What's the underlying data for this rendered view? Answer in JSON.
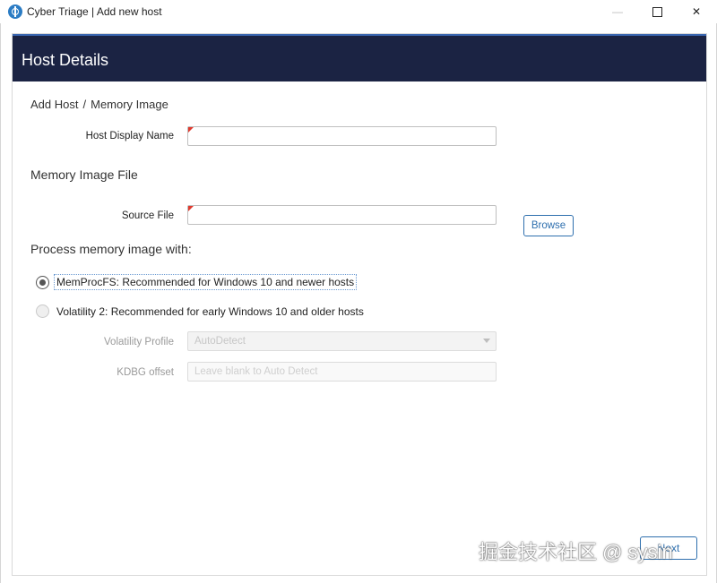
{
  "window": {
    "title": "Cyber Triage | Add new host",
    "minimize_glyph": "—",
    "close_glyph": "✕"
  },
  "header": {
    "title": "Host Details"
  },
  "breadcrumb": {
    "items": [
      "Add Host",
      "Memory Image"
    ],
    "separator": "/"
  },
  "host_name": {
    "label": "Host Display Name",
    "value": "",
    "placeholder": ""
  },
  "memory_section": {
    "title": "Memory Image File"
  },
  "source_file": {
    "label": "Source File",
    "value": "",
    "placeholder": "",
    "browse_label": "Browse"
  },
  "process_section": {
    "title": "Process memory image with:"
  },
  "options": [
    {
      "label": "MemProcFS: Recommended for Windows 10 and newer hosts",
      "selected": true
    },
    {
      "label": "Volatility 2: Recommended for early Windows 10 and older hosts",
      "selected": false
    }
  ],
  "volatility_profile": {
    "label": "Volatility Profile",
    "value": "AutoDetect",
    "enabled": false
  },
  "kdbg_offset": {
    "label": "KDBG offset",
    "value": "",
    "placeholder": "Leave blank to Auto Detect",
    "enabled": false
  },
  "footer": {
    "next_label": "Next"
  },
  "watermark": "掘金技术社区 @ sysin",
  "colors": {
    "header_bg": "#1b2343",
    "accent": "#2e6fae",
    "required_marker": "#e03a2e"
  }
}
